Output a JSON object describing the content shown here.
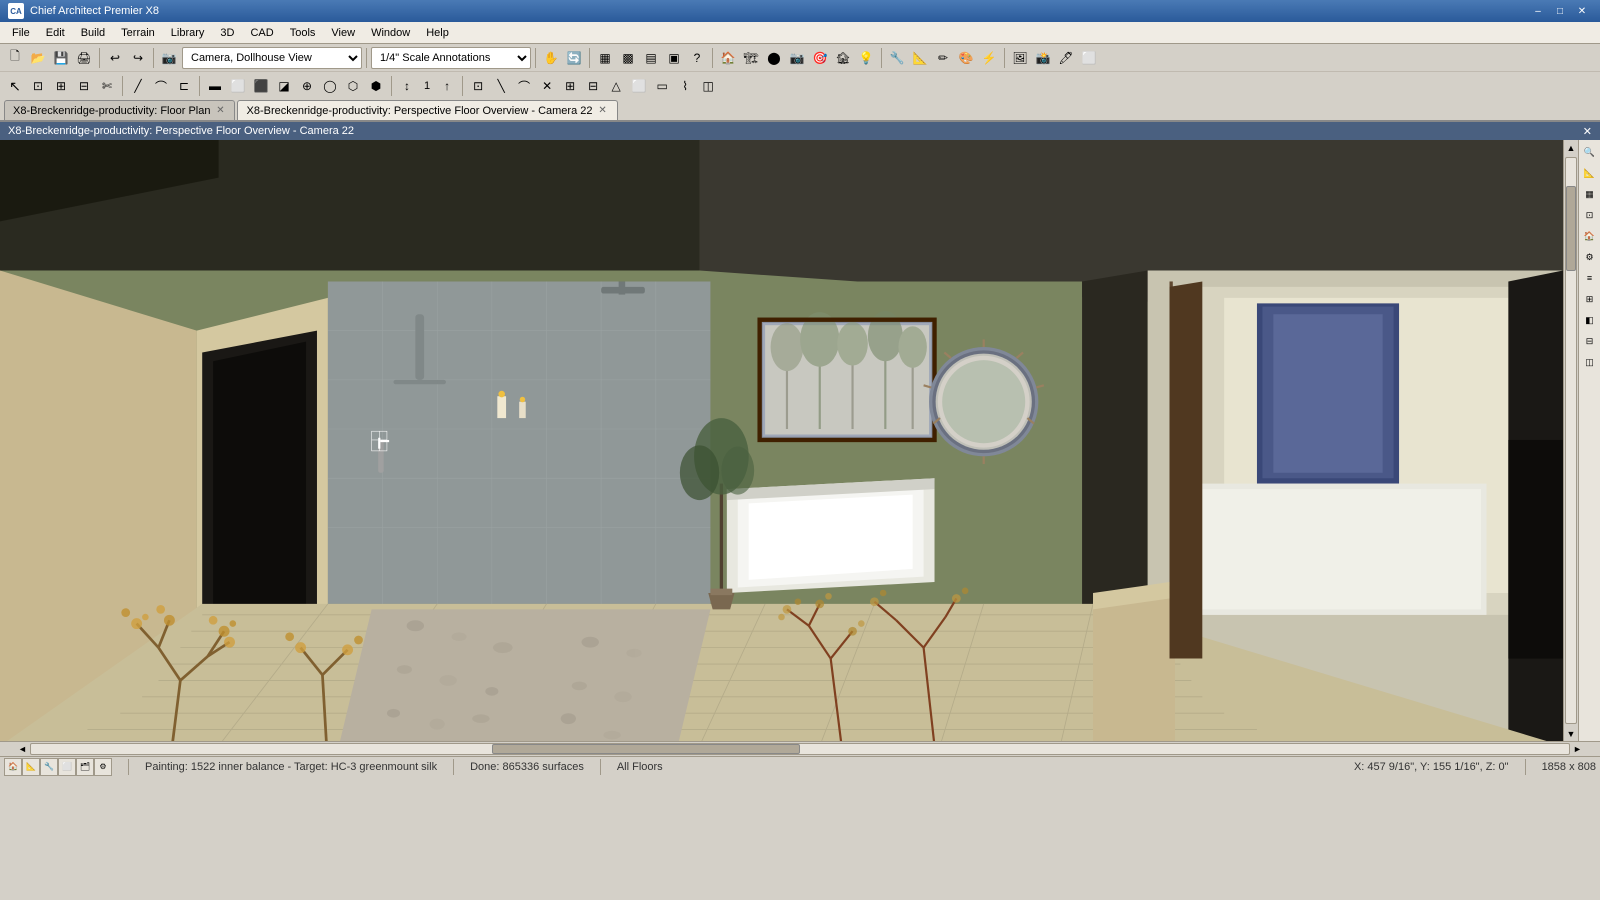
{
  "app": {
    "title": "Chief Architect Premier X8",
    "icon_text": "CA"
  },
  "window_controls": {
    "minimize": "–",
    "maximize": "□",
    "close": "✕"
  },
  "menu": {
    "items": [
      "File",
      "Edit",
      "Build",
      "Terrain",
      "Library",
      "3D",
      "CAD",
      "Tools",
      "View",
      "Window",
      "Help"
    ]
  },
  "toolbar": {
    "camera_dropdown": "Camera, Dollhouse View",
    "scale_dropdown": "1/4\" Scale Annotations"
  },
  "tabs": [
    {
      "id": "tab1",
      "label": "X8-Breckenridge-productivity: Floor Plan",
      "active": false,
      "closable": true
    },
    {
      "id": "tab2",
      "label": "X8-Breckenridge-productivity: Perspective Floor Overview - Camera 22",
      "active": true,
      "closable": true
    }
  ],
  "view_title": "X8-Breckenridge-productivity: Perspective Floor Overview - Camera 22",
  "right_panel_icons": [
    "🔍",
    "📐",
    "🏗",
    "📏",
    "🏠",
    "⚙"
  ],
  "status_bar": {
    "painting_info": "Painting: 1522 inner balance - Target: HC-3 greenmount silk",
    "done_info": "Done: 865336 surfaces",
    "floors_info": "All Floors",
    "coordinates": "X: 457 9/16\", Y: 155 1/16\", Z: 0\"",
    "dimensions": "1858 x 808"
  }
}
